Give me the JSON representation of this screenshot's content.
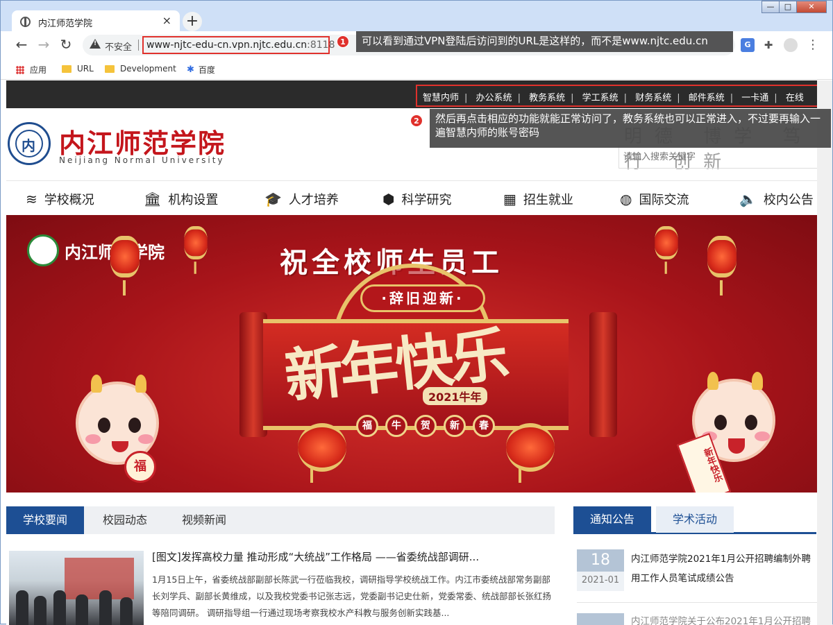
{
  "browser": {
    "tab_title": "内江师范学院",
    "tab_close": "×",
    "new_tab": "+",
    "win_min": "—",
    "win_max": "□",
    "win_close": "✕",
    "back": "←",
    "forward": "→",
    "reload": "↻",
    "insecure_label": "不安全",
    "url_host": "www-njtc-edu-cn.vpn.njtc.edu.cn",
    "url_port": ":8118",
    "ext_translate": "G",
    "ext_puzzle": "✚",
    "menu": "⋮"
  },
  "bookmarks": [
    {
      "label": "应用"
    },
    {
      "label": "URL"
    },
    {
      "label": "Development"
    },
    {
      "label": "百度"
    }
  ],
  "annotations": {
    "one_num": "1",
    "one_text": "可以看到通过VPN登陆后访问到的URL是这样的，而不是www.njtc.edu.cn",
    "two_num": "2",
    "two_text": "然后再点击相应的功能就能正常访问了，教务系统也可以正常进入，不过要再输入一遍智慧内师的账号密码"
  },
  "toplinks": [
    "智慧内师",
    "办公系统",
    "教务系统",
    "学工系统",
    "财务系统",
    "邮件系统",
    "一卡通",
    "在线"
  ],
  "toplinks_sep": "|",
  "header": {
    "cn_name": "内江师范学院",
    "en_name": "Neijiang Normal University",
    "motto": "明德 博学 笃行 创新",
    "search_placeholder": "请输入搜索关键字"
  },
  "mainnav": [
    {
      "label": "学校概况",
      "icon": "≋"
    },
    {
      "label": "机构设置",
      "icon": "🏛"
    },
    {
      "label": "人才培养",
      "icon": "🎓"
    },
    {
      "label": "科学研究",
      "icon": "⬢"
    },
    {
      "label": "招生就业",
      "icon": "▦"
    },
    {
      "label": "国际交流",
      "icon": "◍"
    },
    {
      "label": "校内公告",
      "icon": "🔈"
    }
  ],
  "banner": {
    "logo_text": "内江师范学院",
    "headline": "祝全校师生员工",
    "plaque": "·辞旧迎新·",
    "big_text": "新年快乐",
    "year": "2021牛年",
    "coins": [
      "福",
      "牛",
      "贺",
      "新",
      "春"
    ],
    "fu": "福",
    "couplet": "新年快乐"
  },
  "news": {
    "tabs": [
      "学校要闻",
      "校园动态",
      "视频新闻"
    ],
    "active_tab": 0,
    "title": "[图文]发挥高校力量 推动形成“大统战”工作格局 ——省委统战部调研...",
    "body": "1月15日上午，省委统战部副部长陈武一行莅临我校，调研指导学校统战工作。内江市委统战部常务副部长刘学兵、副部长黄维成，以及我校党委书记张志远，党委副书记史仕新，党委常委、统战部部长张红扬等陪同调研。 调研指导组一行通过现场考察我校水产科教与服务创新实践基..."
  },
  "notices": {
    "tabs": [
      "通知公告",
      "学术活动"
    ],
    "active_tab": 0,
    "items": [
      {
        "day": "18",
        "month": "2021-01",
        "text": "内江师范学院2021年1月公开招聘编制外聘用工作人员笔试成绩公告"
      },
      {
        "text": "内江师范学院关于公布2021年1月公开招聘"
      }
    ]
  },
  "colors": {
    "accent_blue": "#1d4f94",
    "brand_red": "#c4161c",
    "annotation_red": "#e0312c"
  }
}
